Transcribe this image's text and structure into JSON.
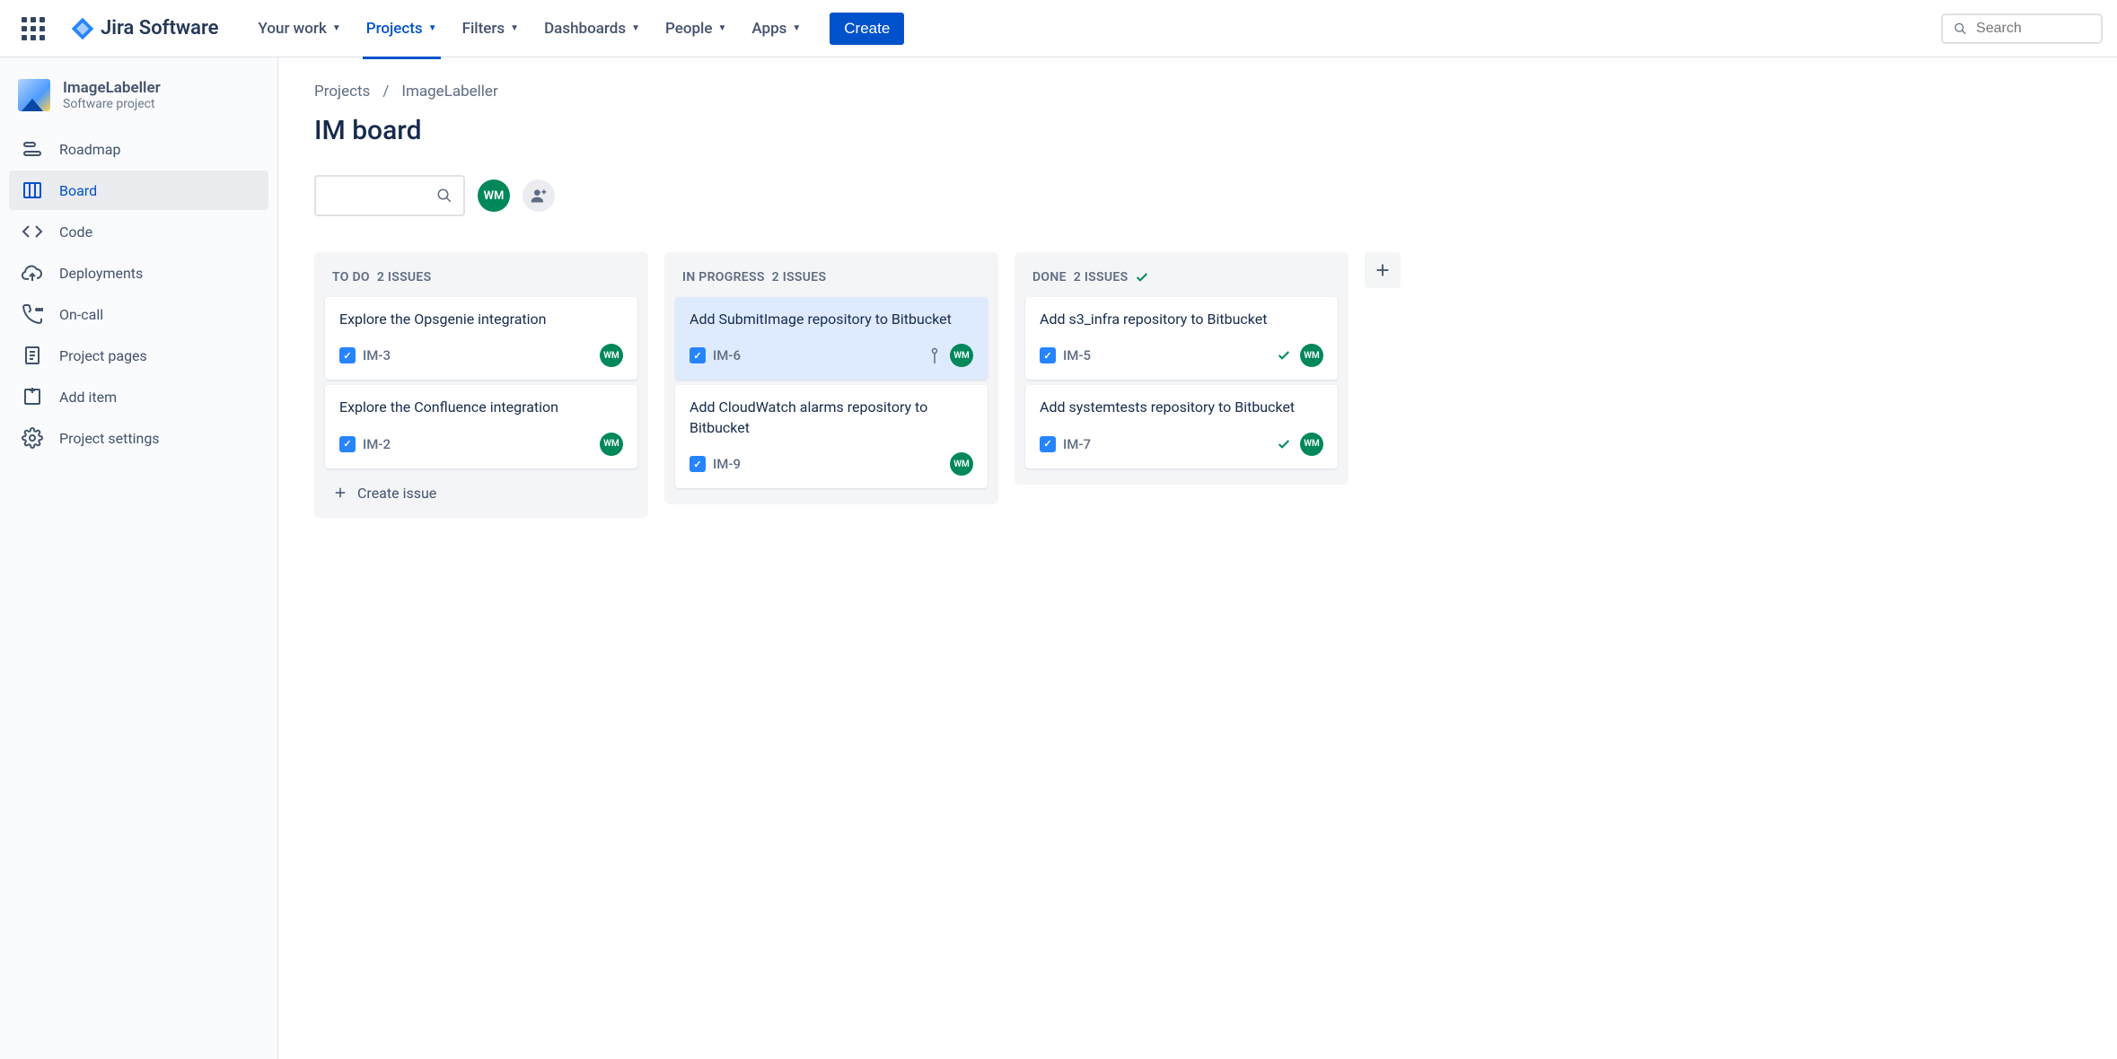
{
  "nav": {
    "logo_text": "Jira Software",
    "items": [
      {
        "label": "Your work"
      },
      {
        "label": "Projects"
      },
      {
        "label": "Filters"
      },
      {
        "label": "Dashboards"
      },
      {
        "label": "People"
      },
      {
        "label": "Apps"
      }
    ],
    "create": "Create",
    "search_placeholder": "Search"
  },
  "sidebar": {
    "project_name": "ImageLabeller",
    "project_type": "Software project",
    "items": [
      {
        "label": "Roadmap"
      },
      {
        "label": "Board"
      },
      {
        "label": "Code"
      },
      {
        "label": "Deployments"
      },
      {
        "label": "On-call"
      },
      {
        "label": "Project pages"
      },
      {
        "label": "Add item"
      },
      {
        "label": "Project settings"
      }
    ]
  },
  "breadcrumb": {
    "root": "Projects",
    "project": "ImageLabeller"
  },
  "board_title": "IM board",
  "avatar_initials": "WM",
  "columns": [
    {
      "name": "TO DO",
      "count_label": "2 ISSUES",
      "cards": [
        {
          "title": "Explore the Opsgenie integration",
          "key": "IM-3",
          "assignee": "WM"
        },
        {
          "title": "Explore the Confluence integration",
          "key": "IM-2",
          "assignee": "WM"
        }
      ]
    },
    {
      "name": "IN PROGRESS",
      "count_label": "2 ISSUES",
      "cards": [
        {
          "title": "Add SubmitImage repository to Bitbucket",
          "key": "IM-6",
          "assignee": "WM",
          "highlighted": true,
          "priority": true
        },
        {
          "title": "Add CloudWatch alarms repository to Bitbucket",
          "key": "IM-9",
          "assignee": "WM"
        }
      ]
    },
    {
      "name": "DONE",
      "count_label": "2 ISSUES",
      "done": true,
      "cards": [
        {
          "title": "Add s3_infra repository to Bitbucket",
          "key": "IM-5",
          "assignee": "WM",
          "done": true
        },
        {
          "title": "Add systemtests repository to Bitbucket",
          "key": "IM-7",
          "assignee": "WM",
          "done": true
        }
      ]
    }
  ],
  "create_issue_label": "Create issue"
}
